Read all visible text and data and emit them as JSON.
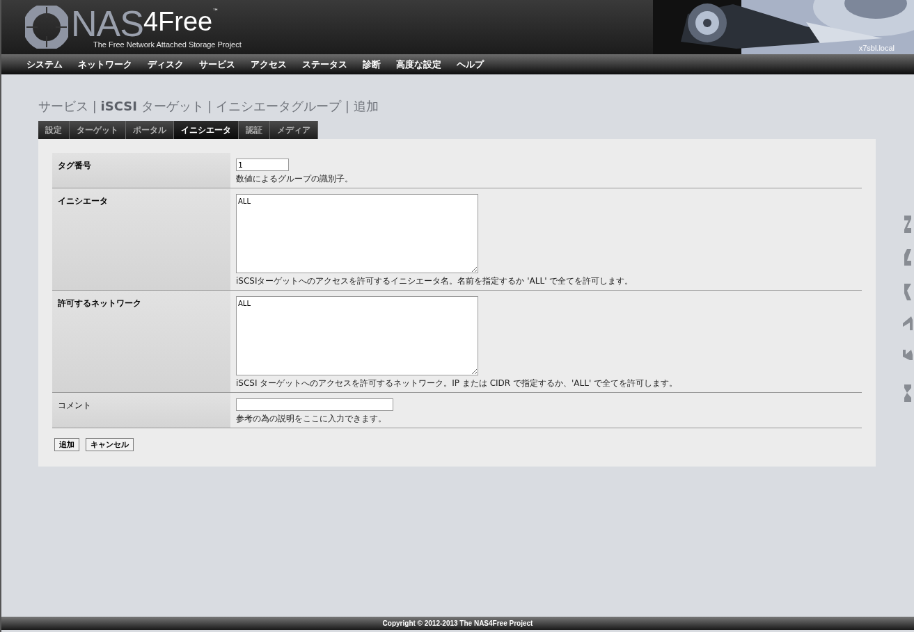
{
  "header": {
    "logo_text": "NAS",
    "logo_text_bold": "4Free",
    "trademark": "™",
    "tagline": "The Free Network Attached Storage Project",
    "hostname": "x7sbl.local"
  },
  "nav": [
    "システム",
    "ネットワーク",
    "ディスク",
    "サービス",
    "アクセス",
    "ステータス",
    "診断",
    "高度な設定",
    "ヘルプ"
  ],
  "breadcrumb": "サービス | **iSCSI** ターゲット | イニシエータグループ | 追加",
  "tabs": [
    {
      "label": "設定",
      "selected": false
    },
    {
      "label": "ターゲット",
      "selected": false
    },
    {
      "label": "ポータル",
      "selected": false
    },
    {
      "label": "イニシエータ",
      "selected": true
    },
    {
      "label": "認証",
      "selected": false
    },
    {
      "label": "メディア",
      "selected": false
    }
  ],
  "form": [
    {
      "kind": "input",
      "label": "タグ番号",
      "required": true,
      "value": "1",
      "hint": "数値によるグループの識別子。"
    },
    {
      "kind": "textarea",
      "label": "イニシエータ",
      "required": true,
      "value": "ALL",
      "hint": "iSCSIターゲットへのアクセスを許可するイニシエータ名。名前を指定するか 'ALL' で全てを許可します。"
    },
    {
      "kind": "textarea",
      "label": "許可するネットワーク",
      "required": true,
      "value": "ALL",
      "hint": "iSCSI ターゲットへのアクセスを許可するネットワーク。IP または CIDR で指定するか、'ALL' で全てを許可します。"
    },
    {
      "kind": "wide-input",
      "label": "コメント",
      "required": false,
      "hint": "参考の為の説明をここに入力できます。"
    }
  ],
  "buttons": [
    "追加",
    "キャンセル"
  ],
  "footer": "Copyright © 2012-2013 The NAS4Free Project"
}
